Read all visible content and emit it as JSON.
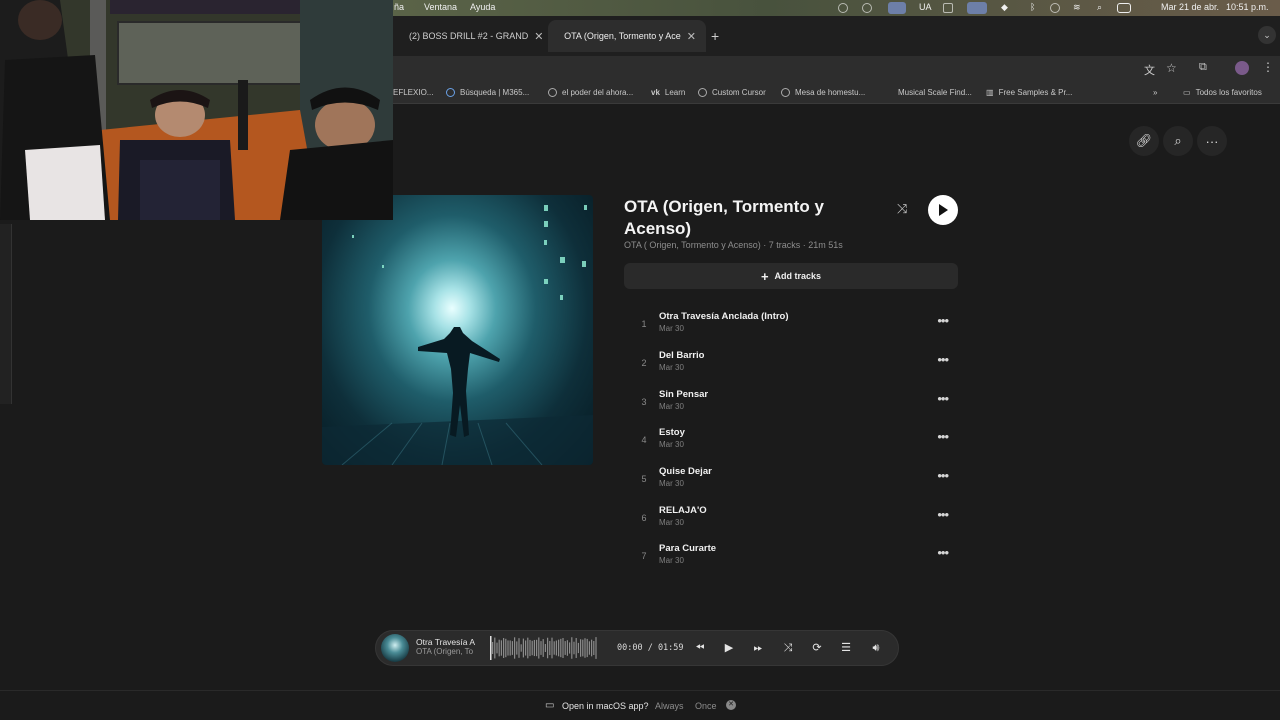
{
  "menubar": {
    "items": [
      "ña",
      "Ventana",
      "Ayuda"
    ],
    "keyboard": "UA",
    "datetime": "Mar 21 de abr.",
    "time": "10:51 p.m."
  },
  "tabs": [
    {
      "title": "(2) BOSS DRILL #2 - GRAND",
      "icon": "youtube-icon"
    },
    {
      "title": "OTA (Origen, Tormento y Ace",
      "icon": "globe-icon"
    }
  ],
  "bookmarks": [
    {
      "label": "EFLEXIO..."
    },
    {
      "label": "Búsqueda | M365..."
    },
    {
      "label": "el poder del ahora..."
    },
    {
      "label": "Learn",
      "prefix": "vk"
    },
    {
      "label": "Custom Cursor"
    },
    {
      "label": "Mesa de homestu..."
    },
    {
      "label": "Musical Scale Find..."
    },
    {
      "label": "Free Samples & Pr..."
    }
  ],
  "bookmarks_overflow": "»",
  "bookmarks_all": "Todos los favoritos",
  "album": {
    "title": "OTA (Origen, Tormento y Acenso)",
    "subtitle": "OTA ( Origen, Tormento y Acenso) · 7 tracks · 21m 51s",
    "add_tracks_label": "Add tracks"
  },
  "tracks": [
    {
      "num": "1",
      "name": "Otra Travesía Anclada (Intro)",
      "date": "Mar 30"
    },
    {
      "num": "2",
      "name": "Del Barrio",
      "date": "Mar 30"
    },
    {
      "num": "3",
      "name": "Sin Pensar",
      "date": "Mar 30"
    },
    {
      "num": "4",
      "name": "Estoy",
      "date": "Mar 30"
    },
    {
      "num": "5",
      "name": "Quise Dejar",
      "date": "Mar 30"
    },
    {
      "num": "6",
      "name": "RELAJA'O",
      "date": "Mar 30"
    },
    {
      "num": "7",
      "name": "Para Curarte",
      "date": "Mar 30"
    }
  ],
  "player": {
    "title": "Otra Travesía A",
    "subtitle": "OTA (Origen, To",
    "time": "00:00 / 01:59",
    "progress": 0
  },
  "open_prompt": {
    "label": "Open in macOS app?",
    "always": "Always",
    "once": "Once"
  },
  "colors": {
    "background": "#1b1b1b",
    "accent": "#ffffff"
  }
}
